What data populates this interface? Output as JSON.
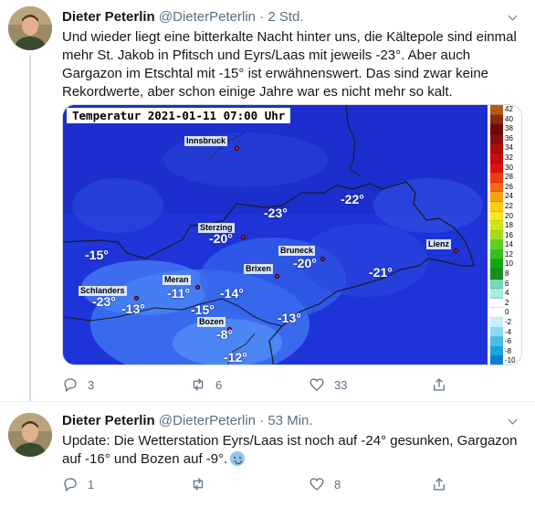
{
  "tweets": [
    {
      "author": "Dieter Peterlin",
      "handle": "@DieterPeterlin",
      "dot": "·",
      "time": "2 Std.",
      "text": "Und wieder liegt eine bitterkalte Nacht hinter uns, die Kältepole sind einmal mehr St. Jakob in Pfitsch und Eyrs/Laas mit jeweils -23°. Aber auch Gargazon im Etschtal mit -15° ist erwähnenswert. Das sind zwar keine Rekordwerte, aber schon einige Jahre war es nicht mehr so kalt.",
      "replies": "3",
      "retweets": "6",
      "likes": "33"
    },
    {
      "author": "Dieter Peterlin",
      "handle": "@DieterPeterlin",
      "dot": "·",
      "time": "53 Min.",
      "text": "Update: Die Wetterstation Eyrs/Laas ist noch auf -24° gesunken, Gargazon auf -16° und Bozen auf -9°.",
      "emoji": "cold-face",
      "replies": "1",
      "retweets": "",
      "likes": "8"
    }
  ],
  "map": {
    "title": "Temperatur 2021-01-11 07:00 Uhr",
    "cities": [
      {
        "name": "Innsbruck"
      },
      {
        "name": "Sterzing"
      },
      {
        "name": "Bruneck"
      },
      {
        "name": "Brixen"
      },
      {
        "name": "Lienz"
      },
      {
        "name": "Schlanders"
      },
      {
        "name": "Meran"
      },
      {
        "name": "Bozen"
      }
    ],
    "temps": [
      "-23°",
      "-22°",
      "-15°",
      "-20°",
      "-20°",
      "-21°",
      "-23°",
      "-13°",
      "-11°",
      "-14°",
      "-15°",
      "-13°",
      "-8°",
      "-12°"
    ],
    "legend": {
      "values": [
        "42",
        "40",
        "38",
        "36",
        "34",
        "32",
        "30",
        "28",
        "26",
        "24",
        "22",
        "20",
        "18",
        "16",
        "14",
        "12",
        "10",
        "8",
        "6",
        "4",
        "2",
        "0",
        "-2",
        "-4",
        "-6",
        "-8",
        "-10"
      ],
      "colors": [
        "#b85a10",
        "#8a2a10",
        "#6e0a0a",
        "#8a1010",
        "#a80c0c",
        "#c80c0c",
        "#e0140e",
        "#f03a10",
        "#f46a12",
        "#f8a014",
        "#fccc18",
        "#f6e81c",
        "#cce81c",
        "#a0e01c",
        "#60d020",
        "#30c020",
        "#10a818",
        "#1c8c1c",
        "#76d8b8",
        "#a8ece0",
        "#ffffff",
        "#ffffff",
        "#c8f0fa",
        "#88dcf4",
        "#40c0ec",
        "#18a4e0",
        "#0c80d0"
      ]
    }
  }
}
